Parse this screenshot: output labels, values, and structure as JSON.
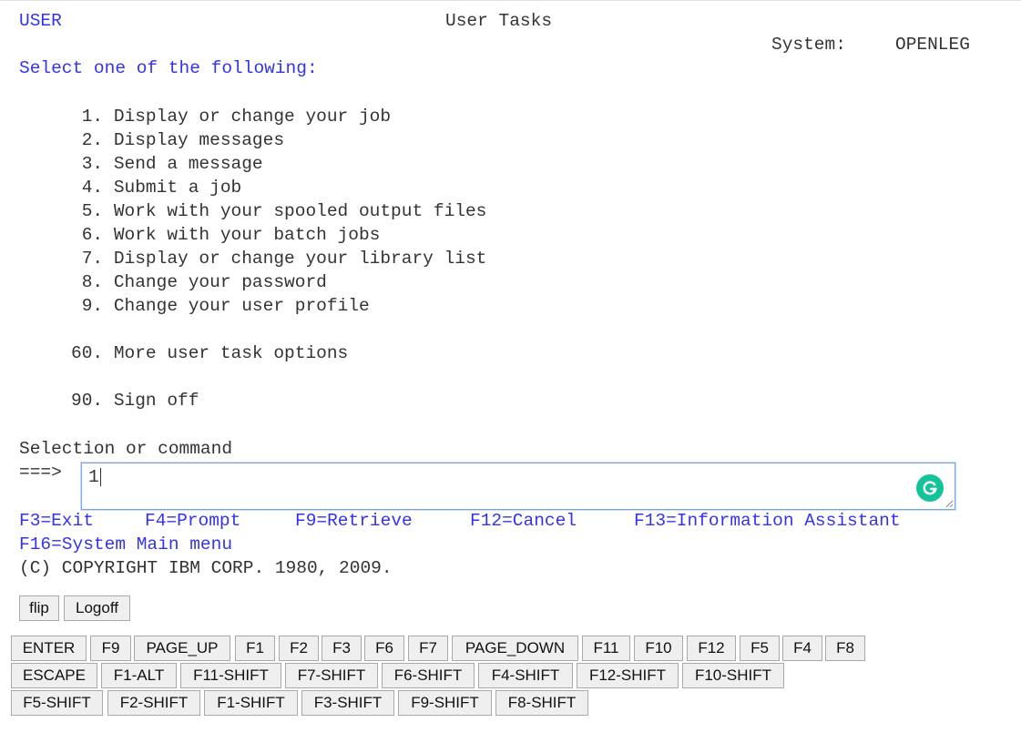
{
  "header": {
    "left": "USER",
    "title": "User Tasks",
    "system_label": "System:",
    "system_name": "OPENLEG"
  },
  "instruction": "Select one of the following:",
  "menu": {
    "items": [
      {
        "num": " 1.",
        "label": "Display or change your job"
      },
      {
        "num": " 2.",
        "label": "Display messages"
      },
      {
        "num": " 3.",
        "label": "Send a message"
      },
      {
        "num": " 4.",
        "label": "Submit a job"
      },
      {
        "num": " 5.",
        "label": "Work with your spooled output files"
      },
      {
        "num": " 6.",
        "label": "Work with your batch jobs"
      },
      {
        "num": " 7.",
        "label": "Display or change your library list"
      },
      {
        "num": " 8.",
        "label": "Change your password"
      },
      {
        "num": " 9.",
        "label": "Change your user profile"
      }
    ],
    "more": {
      "num": "60.",
      "label": "More user task options"
    },
    "signoff": {
      "num": "90.",
      "label": "Sign off"
    }
  },
  "command": {
    "label": "Selection or command",
    "prompt": "===>",
    "value": "1"
  },
  "function_keys": {
    "f3": "F3=Exit",
    "f4": "F4=Prompt",
    "f9": "F9=Retrieve",
    "f12": "F12=Cancel",
    "f13": "F13=Information Assistant",
    "f16": "F16=System Main menu"
  },
  "copyright": "(C) COPYRIGHT IBM CORP. 1980, 2009.",
  "controls": {
    "flip": "flip",
    "logoff": "Logoff"
  },
  "key_buttons": {
    "row1": [
      "ENTER",
      "F9",
      "PAGE_UP",
      "F1",
      "F2",
      "F3",
      "F6",
      "F7",
      "PAGE_DOWN",
      "F11",
      "F10",
      "F12",
      "F5",
      "F4",
      "F8"
    ],
    "row2": [
      "ESCAPE",
      "F1-ALT",
      "F11-SHIFT",
      "F7-SHIFT",
      "F6-SHIFT",
      "F4-SHIFT",
      "F12-SHIFT",
      "F10-SHIFT"
    ],
    "row3": [
      "F5-SHIFT",
      "F2-SHIFT",
      "F1-SHIFT",
      "F3-SHIFT",
      "F9-SHIFT",
      "F8-SHIFT"
    ]
  },
  "icons": {
    "grammarly": "grammarly-icon",
    "grammarly_color": "#15c39a"
  },
  "colors": {
    "blue_text": "#3333ee",
    "dark_text": "#333333"
  }
}
